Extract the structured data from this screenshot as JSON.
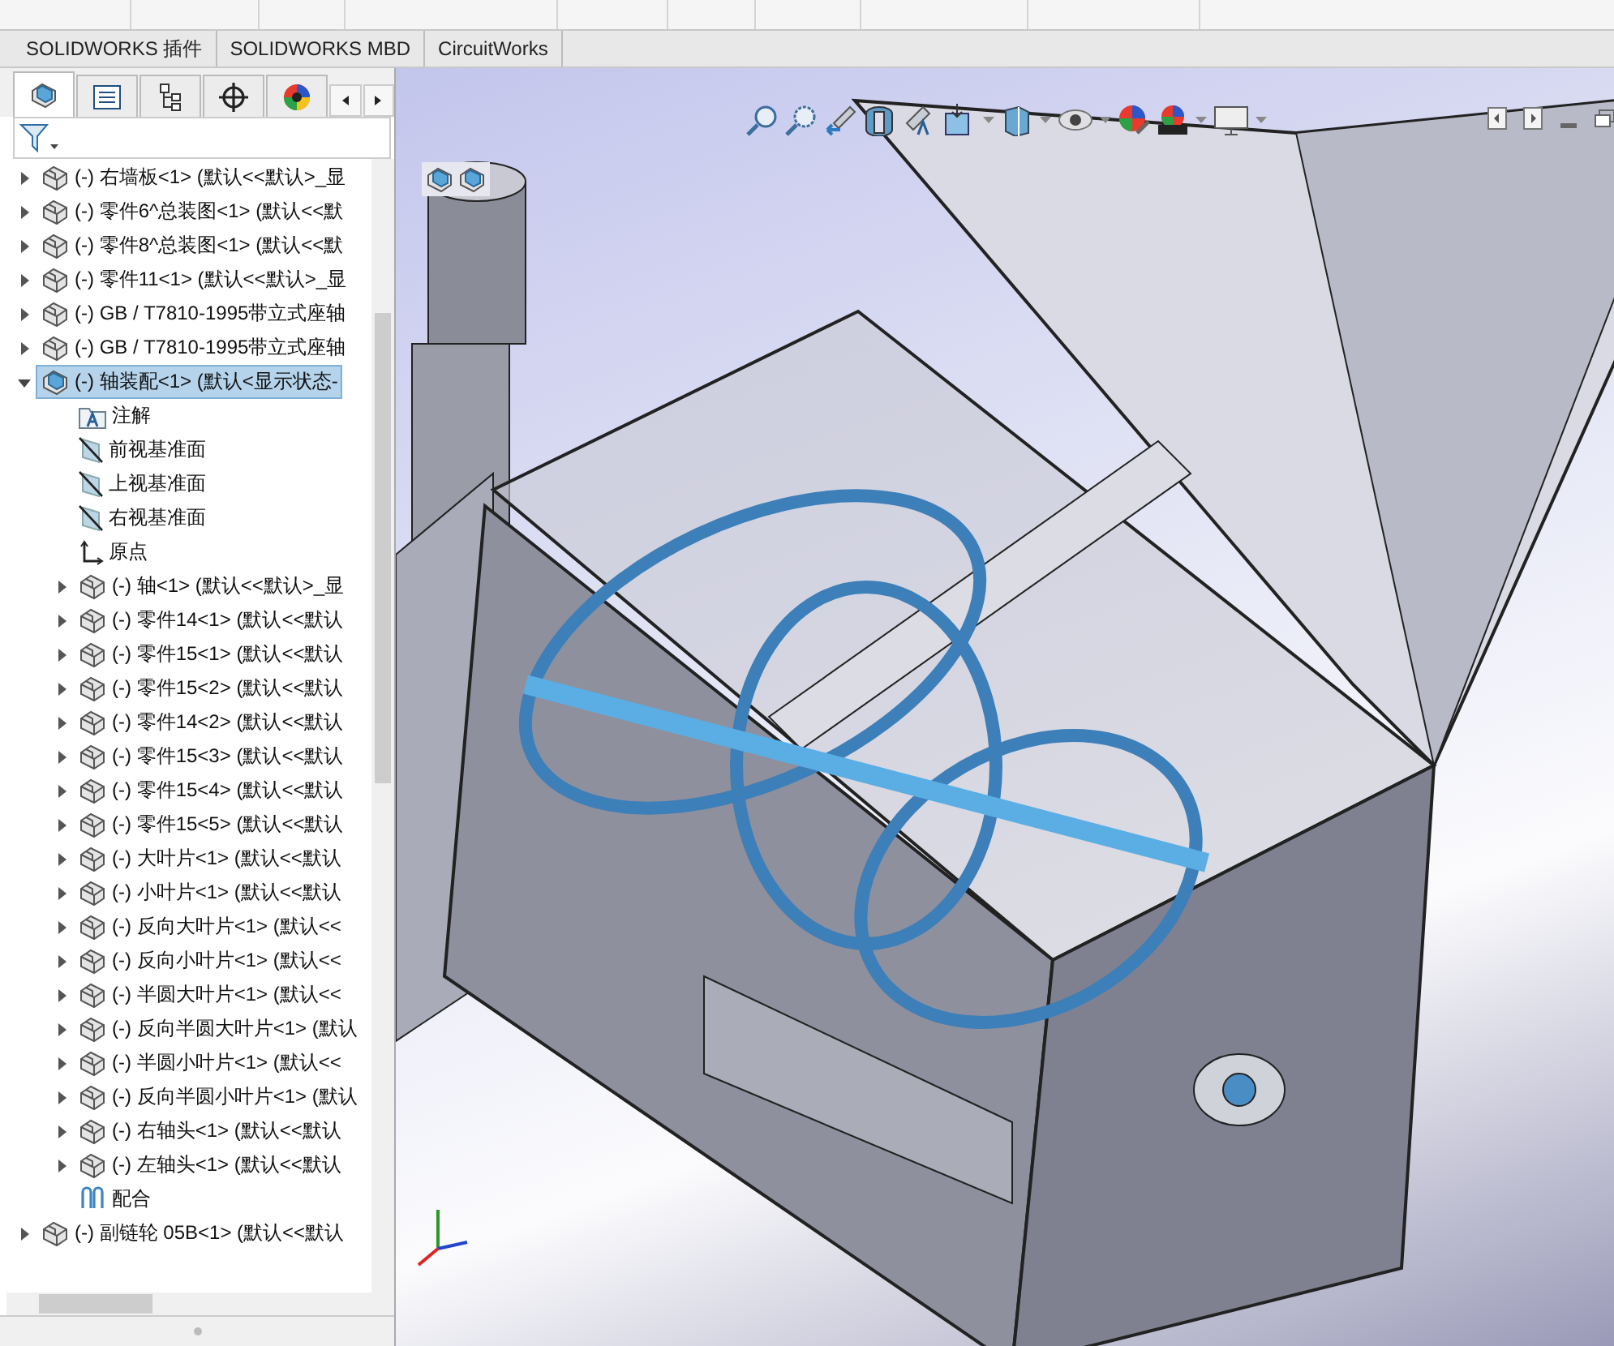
{
  "command_tabs": [
    {
      "label": "SOLIDWORKS 插件",
      "selected": false
    },
    {
      "label": "SOLIDWORKS MBD",
      "selected": false
    },
    {
      "label": "CircuitWorks",
      "selected": false
    }
  ],
  "panel_tabs": [
    {
      "kind": "feature",
      "selected": true
    },
    {
      "kind": "property",
      "selected": false
    },
    {
      "kind": "config",
      "selected": false
    },
    {
      "kind": "dim",
      "selected": false
    },
    {
      "kind": "appearance",
      "selected": false
    }
  ],
  "tree": [
    {
      "kind": "part",
      "label": "(-) 右墙板<1> (默认<<默认>_显",
      "expanded": false,
      "selected": false
    },
    {
      "kind": "part",
      "label": "(-) 零件6^总装图<1> (默认<<默",
      "expanded": false,
      "selected": false
    },
    {
      "kind": "part",
      "label": "(-) 零件8^总装图<1> (默认<<默",
      "expanded": false,
      "selected": false
    },
    {
      "kind": "part",
      "label": "(-) 零件11<1> (默认<<默认>_显",
      "expanded": false,
      "selected": false
    },
    {
      "kind": "part",
      "label": "(-) GB / T7810-1995带立式座轴",
      "expanded": false,
      "selected": false
    },
    {
      "kind": "part",
      "label": "(-) GB / T7810-1995带立式座轴",
      "expanded": false,
      "selected": false
    },
    {
      "kind": "assembly",
      "label": "(-) 轴装配<1> (默认<显示状态-",
      "expanded": true,
      "selected": true,
      "children": [
        {
          "kind": "annotation",
          "label": "注解",
          "selected": false
        },
        {
          "kind": "plane",
          "label": "前视基准面",
          "selected": false
        },
        {
          "kind": "plane",
          "label": "上视基准面",
          "selected": false
        },
        {
          "kind": "plane",
          "label": "右视基准面",
          "selected": false
        },
        {
          "kind": "origin",
          "label": "原点",
          "selected": false
        },
        {
          "kind": "part",
          "label": "(-) 轴<1> (默认<<默认>_显",
          "expanded": false,
          "selected": false
        },
        {
          "kind": "part",
          "label": "(-) 零件14<1> (默认<<默认",
          "expanded": false,
          "selected": false
        },
        {
          "kind": "part",
          "label": "(-) 零件15<1> (默认<<默认",
          "expanded": false,
          "selected": false
        },
        {
          "kind": "part",
          "label": "(-) 零件15<2> (默认<<默认",
          "expanded": false,
          "selected": false
        },
        {
          "kind": "part",
          "label": "(-) 零件14<2> (默认<<默认",
          "expanded": false,
          "selected": false
        },
        {
          "kind": "part",
          "label": "(-) 零件15<3> (默认<<默认",
          "expanded": false,
          "selected": false
        },
        {
          "kind": "part",
          "label": "(-) 零件15<4> (默认<<默认",
          "expanded": false,
          "selected": false
        },
        {
          "kind": "part",
          "label": "(-) 零件15<5> (默认<<默认",
          "expanded": false,
          "selected": false
        },
        {
          "kind": "part",
          "label": "(-) 大叶片<1> (默认<<默认",
          "expanded": false,
          "selected": false
        },
        {
          "kind": "part",
          "label": "(-) 小叶片<1> (默认<<默认",
          "expanded": false,
          "selected": false
        },
        {
          "kind": "part",
          "label": "(-) 反向大叶片<1> (默认<<",
          "expanded": false,
          "selected": false
        },
        {
          "kind": "part",
          "label": "(-) 反向小叶片<1> (默认<<",
          "expanded": false,
          "selected": false
        },
        {
          "kind": "part",
          "label": "(-) 半圆大叶片<1> (默认<<",
          "expanded": false,
          "selected": false
        },
        {
          "kind": "part",
          "label": "(-) 反向半圆大叶片<1> (默认",
          "expanded": false,
          "selected": false
        },
        {
          "kind": "part",
          "label": "(-) 半圆小叶片<1> (默认<<",
          "expanded": false,
          "selected": false
        },
        {
          "kind": "part",
          "label": "(-) 反向半圆小叶片<1> (默认",
          "expanded": false,
          "selected": false
        },
        {
          "kind": "part",
          "label": "(-) 右轴头<1> (默认<<默认",
          "expanded": false,
          "selected": false
        },
        {
          "kind": "part",
          "label": "(-) 左轴头<1> (默认<<默认",
          "expanded": false,
          "selected": false
        },
        {
          "kind": "mate",
          "label": "配合",
          "selected": false
        }
      ]
    },
    {
      "kind": "part",
      "label": "(-) 副链轮 05B<1> (默认<<默认",
      "expanded": false,
      "selected": false
    }
  ]
}
